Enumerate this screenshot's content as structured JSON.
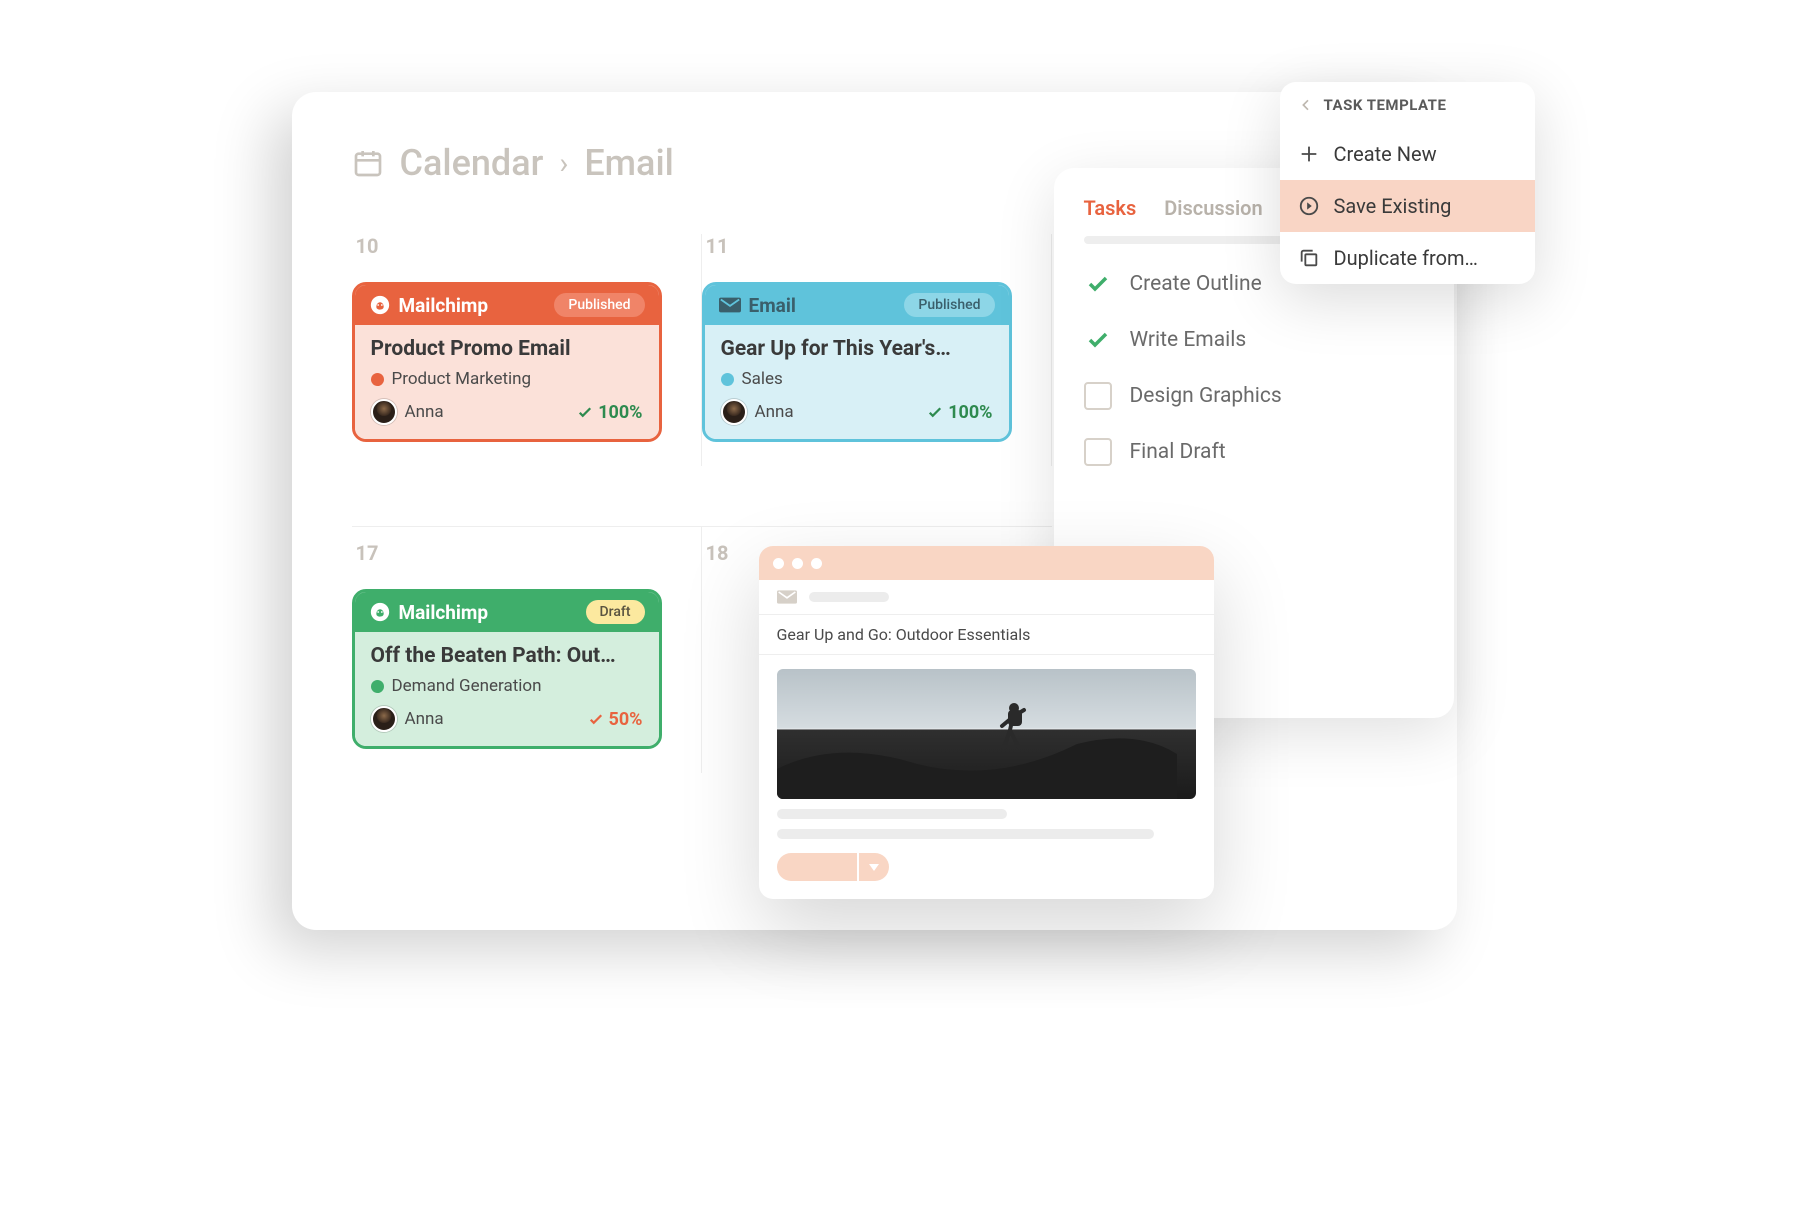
{
  "breadcrumb": {
    "root": "Calendar",
    "current": "Email"
  },
  "days": {
    "r1c1": "10",
    "r1c2": "11",
    "r2c1": "17",
    "r2c2": "18"
  },
  "cards": {
    "a": {
      "channel": "Mailchimp",
      "status": "Published",
      "title": "Product Promo Email",
      "tag": "Product Marketing",
      "tag_color": "#e8633f",
      "assignee": "Anna",
      "progress": "100%"
    },
    "b": {
      "channel": "Email",
      "status": "Published",
      "title": "Gear Up for This Year's…",
      "tag": "Sales",
      "tag_color": "#5fc3db",
      "assignee": "Anna",
      "progress": "100%"
    },
    "c": {
      "channel": "Mailchimp",
      "status": "Draft",
      "title": "Off the Beaten Path: Out…",
      "tag": "Demand Generation",
      "tag_color": "#3fae6b",
      "assignee": "Anna",
      "progress": "50%"
    }
  },
  "tasks_panel": {
    "tabs": {
      "t0": "Tasks",
      "t1": "Discussion"
    },
    "items": {
      "i0": {
        "label": "Create Outline",
        "done": true
      },
      "i1": {
        "label": "Write Emails",
        "done": true
      },
      "i2": {
        "label": "Design Graphics",
        "done": false
      },
      "i3": {
        "label": "Final Draft",
        "done": false
      }
    }
  },
  "template_menu": {
    "header": "TASK TEMPLATE",
    "items": {
      "m0": "Create New",
      "m1": "Save Existing",
      "m2": "Duplicate from…"
    }
  },
  "preview": {
    "subject": "Gear Up and Go: Outdoor Essentials"
  }
}
